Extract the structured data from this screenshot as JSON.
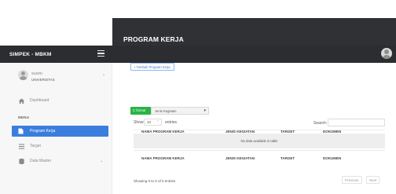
{
  "app": {
    "brand": "SIMPEK - MBKM"
  },
  "page": {
    "title": "PROGRAM KERJA"
  },
  "user": {
    "name": "SUKRI",
    "role": "UNIVERSITAS"
  },
  "sidebar": {
    "menu_heading": "MENU",
    "items": [
      {
        "label": "Dashboard",
        "icon": "home-icon"
      },
      {
        "label": "Program Kerja",
        "icon": "file-icon",
        "active": true
      },
      {
        "label": "Target",
        "icon": "list-icon"
      },
      {
        "label": "Data Master",
        "icon": "database-icon"
      }
    ]
  },
  "toolbar": {
    "add_label": "+ Tambah Program Kerja",
    "export_label": "C format",
    "filter_value": "Jenis Kegiatan"
  },
  "table": {
    "show_label": "Show",
    "show_value": "10",
    "entries_label": "entries",
    "search_label": "Search:",
    "columns": [
      "NAMA PROGRAM KERJA",
      "JENIS KEGIATAN",
      "TARGET",
      "DOKUMEN"
    ],
    "empty_text": "No data available in table",
    "info": "Showing 0 to 0 of 0 entries",
    "prev_label": "Previous",
    "next_label": "Next"
  },
  "colors": {
    "header_dark": "#2f3134",
    "nav_dark": "#2b2d30",
    "accent": "#3b7ddd",
    "success": "#28b446"
  }
}
